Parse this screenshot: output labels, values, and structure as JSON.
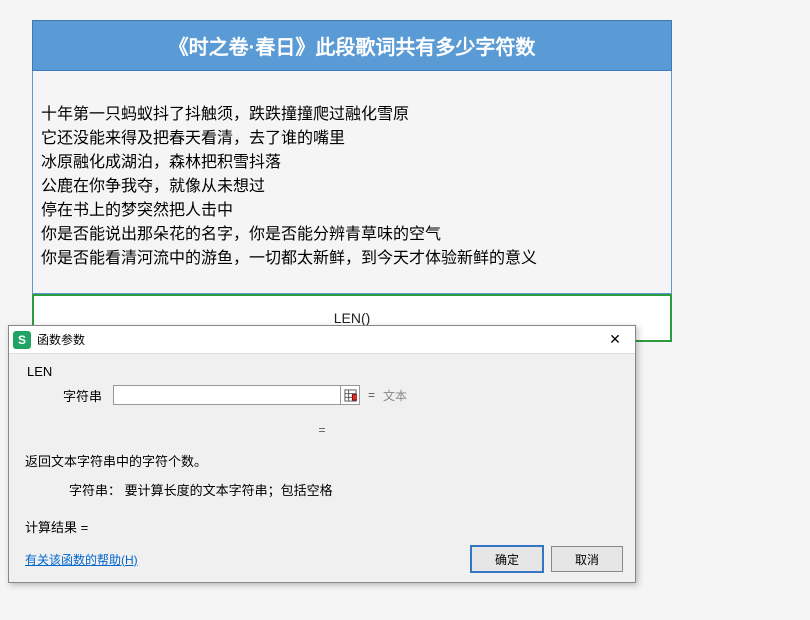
{
  "worksheet": {
    "title": "《时之卷·春日》此段歌词共有多少字符数",
    "lyrics": [
      "十年第一只蚂蚁抖了抖触须，跌跌撞撞爬过融化雪原",
      "它还没能来得及把春天看清，去了谁的嘴里",
      "冰原融化成湖泊，森林把积雪抖落",
      "公鹿在你争我夺，就像从未想过",
      "停在书上的梦突然把人击中",
      "你是否能说出那朵花的名字，你是否能分辨青草味的空气",
      "你是否能看清河流中的游鱼，一切都太新鲜，到今天才体验新鲜的意义"
    ],
    "formula_placeholder": "LEN()"
  },
  "dialog": {
    "title": "函数参数",
    "icon_letter": "S",
    "fn_name": "LEN",
    "arg_label": "字符串",
    "arg_value": "",
    "arg_eq": "=",
    "arg_placeholder": "文本",
    "result_eq": "=",
    "desc": "返回文本字符串中的字符个数。",
    "arg_desc_label": "字符串：",
    "arg_desc_text": "要计算长度的文本字符串；包括空格",
    "calc_result_label": "计算结果 =",
    "calc_result_value": "",
    "help_link": "有关该函数的帮助(H)",
    "ok": "确定",
    "cancel": "取消"
  }
}
